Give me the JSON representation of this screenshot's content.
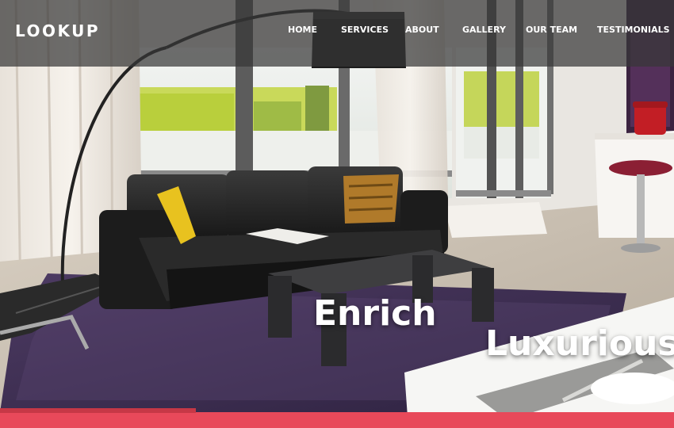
{
  "brand": {
    "name": "LOOKUP"
  },
  "nav": {
    "items": [
      {
        "label": "HOME"
      },
      {
        "label": "SERVICES"
      },
      {
        "label": "ABOUT"
      },
      {
        "label": "GALLERY"
      },
      {
        "label": "OUR TEAM"
      },
      {
        "label": "TESTIMONIALS"
      }
    ]
  },
  "hero": {
    "headline_1": "Enrich",
    "headline_2": "Luxurious",
    "slider_progress_percent": 29
  },
  "colors": {
    "accent": "#e8495a",
    "accent_dark": "#c63846",
    "navbar": "#373737"
  }
}
